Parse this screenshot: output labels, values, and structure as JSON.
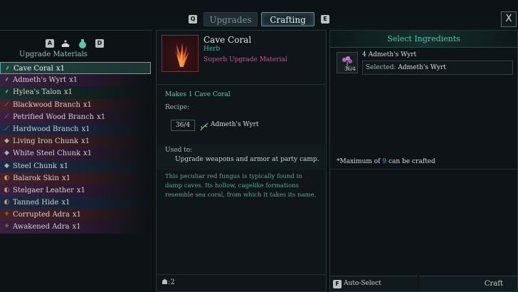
{
  "header": {
    "left_key": "Q",
    "right_key": "E",
    "tabs": [
      {
        "label": "Upgrades",
        "active": false
      },
      {
        "label": "Crafting",
        "active": true
      }
    ],
    "close_label": "X"
  },
  "sidebar": {
    "filter_left_key": "A",
    "filter_right_key": "D",
    "filters": [
      "all-items-icon",
      "potion-icon"
    ],
    "title": "Upgrade Materials",
    "items": [
      {
        "label": "Cave Coral",
        "qty": "x1",
        "selected": true,
        "rarity": "green",
        "icon": "herb-icon"
      },
      {
        "label": "Admeth's Wyrt",
        "qty": "x1",
        "selected": false,
        "rarity": "purple",
        "icon": "herb-icon"
      },
      {
        "label": "Hylea's Talon",
        "qty": "x1",
        "selected": false,
        "rarity": "green",
        "icon": "herb-icon"
      },
      {
        "label": "Blackwood Branch",
        "qty": "x1",
        "selected": false,
        "rarity": "red",
        "icon": "branch-icon"
      },
      {
        "label": "Petrified Wood Branch",
        "qty": "x1",
        "selected": false,
        "rarity": "purple",
        "icon": "branch-icon"
      },
      {
        "label": "Hardwood Branch",
        "qty": "x1",
        "selected": false,
        "rarity": "blue",
        "icon": "branch-icon"
      },
      {
        "label": "Living Iron Chunk",
        "qty": "x1",
        "selected": false,
        "rarity": "red",
        "icon": "ore-icon"
      },
      {
        "label": "White Steel Chunk",
        "qty": "x1",
        "selected": false,
        "rarity": "purple",
        "icon": "ore-icon"
      },
      {
        "label": "Steel Chunk",
        "qty": "x1",
        "selected": false,
        "rarity": "blue",
        "icon": "ore-icon"
      },
      {
        "label": "Balarok Skin",
        "qty": "x1",
        "selected": false,
        "rarity": "red",
        "icon": "leather-icon"
      },
      {
        "label": "Stelgaer Leather",
        "qty": "x1",
        "selected": false,
        "rarity": "purple",
        "icon": "leather-icon"
      },
      {
        "label": "Tanned Hide",
        "qty": "x1",
        "selected": false,
        "rarity": "blue",
        "icon": "leather-icon"
      },
      {
        "label": "Corrupted Adra",
        "qty": "x1",
        "selected": false,
        "rarity": "red",
        "icon": "adra-icon"
      },
      {
        "label": "Awakened Adra",
        "qty": "x1",
        "selected": false,
        "rarity": "purple",
        "icon": "adra-icon"
      }
    ]
  },
  "detail": {
    "name": "Cave Coral",
    "type": "Herb",
    "rarity": "Superb Upgrade Material",
    "makes": "Makes 1 Cave Coral",
    "recipe_label": "Recipe:",
    "recipe": {
      "count": "36/4",
      "ingredient": "Admeth's Wyrt"
    },
    "used_to_label": "Used to:",
    "used_to": "Upgrade weapons and armor at party camp.",
    "description": "This peculiar red fungus is typically found in damp caves. Its hollow, cagelike formations resemble sea coral, from which it takes its name.",
    "footer_count": ":2"
  },
  "ingredients": {
    "title": "Select Ingredients",
    "item": {
      "name": "4 Admeth's Wyrt",
      "count": "36/4",
      "selected_label": "Selected:",
      "selected_value": "Admeth's Wyrt"
    },
    "max_prefix": "*Maximum of ",
    "max_value": "9",
    "max_suffix": " can be crafted",
    "auto_key": "F",
    "auto_label": "Auto-Select Ingredients",
    "craft_label": "Craft"
  },
  "colors": {
    "accent": "#5fc2ae",
    "rarity_superb": "#e0479a",
    "highlight_number": "#3fb0e0"
  }
}
